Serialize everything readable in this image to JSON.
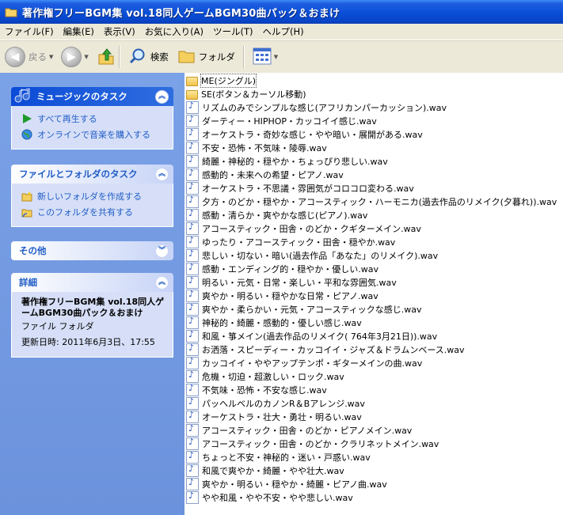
{
  "window": {
    "title": "著作権フリーBGM集 vol.18同人ゲームBGM30曲パック＆おまけ"
  },
  "menu": [
    "ファイル(F)",
    "編集(E)",
    "表示(V)",
    "お気に入り(A)",
    "ツール(T)",
    "ヘルプ(H)"
  ],
  "toolbar": {
    "back": "戻る",
    "search": "検索",
    "folders": "フォルダ"
  },
  "tasks": {
    "music": {
      "title": "ミュージックのタスク",
      "items": [
        "すべて再生する",
        "オンラインで音楽を購入する"
      ]
    },
    "file": {
      "title": "ファイルとフォルダのタスク",
      "items": [
        "新しいフォルダを作成する",
        "このフォルダを共有する"
      ]
    },
    "other": {
      "title": "その他"
    },
    "details": {
      "title": "詳細",
      "name": "著作権フリーBGM集 vol.18同人ゲームBGM30曲パック＆おまけ",
      "type": "ファイル フォルダ",
      "modified": "更新日時: 2011年6月3日、17:55"
    }
  },
  "files": [
    {
      "name": "ME(ジングル)",
      "type": "folder"
    },
    {
      "name": "SE(ボタン＆カーソル移動)",
      "type": "folder"
    },
    {
      "name": "リズムのみでシンプルな感じ(アフリカンパーカッション).wav",
      "type": "audio"
    },
    {
      "name": "ダーティー・HIPHOP・カッコイイ感じ.wav",
      "type": "audio"
    },
    {
      "name": "オーケストラ・奇妙な感じ・やや暗い・展開がある.wav",
      "type": "audio"
    },
    {
      "name": "不安・恐怖・不気味・陵辱.wav",
      "type": "audio"
    },
    {
      "name": "綺麗・神秘的・穏やか・ちょっぴり悲しい.wav",
      "type": "audio"
    },
    {
      "name": "感動的・未来への希望・ピアノ.wav",
      "type": "audio"
    },
    {
      "name": "オーケストラ・不思議・雰囲気がコロコロ変わる.wav",
      "type": "audio"
    },
    {
      "name": "夕方・のどか・穏やか・アコースティック・ハーモニカ(過去作品のリメイク(夕暮れ)).wav",
      "type": "audio"
    },
    {
      "name": "感動・清らか・爽やかな感じ(ピアノ).wav",
      "type": "audio"
    },
    {
      "name": "アコースティック・田舎・のどか・クギターメイン.wav",
      "type": "audio"
    },
    {
      "name": "ゆったり・アコースティック・田舎・穏やか.wav",
      "type": "audio"
    },
    {
      "name": "悲しい・切ない・暗い(過去作品「あなた」のリメイク).wav",
      "type": "audio"
    },
    {
      "name": "感動・エンディング的・穏やか・優しい.wav",
      "type": "audio"
    },
    {
      "name": "明るい・元気・日常・楽しい・平和な雰囲気.wav",
      "type": "audio"
    },
    {
      "name": "爽やか・明るい・穏やかな日常・ピアノ.wav",
      "type": "audio"
    },
    {
      "name": "爽やか・柔らかい・元気・アコースティックな感じ.wav",
      "type": "audio"
    },
    {
      "name": "神秘的・綺麗・感動的・優しい感じ.wav",
      "type": "audio"
    },
    {
      "name": "和風・箏メイン(過去作品のリメイク( 764年3月21日)).wav",
      "type": "audio"
    },
    {
      "name": "お洒落・スピーディー・カッコイイ・ジャズ＆ドラムンベース.wav",
      "type": "audio"
    },
    {
      "name": "カッコイイ・ややアップテンポ・ギターメインの曲.wav",
      "type": "audio"
    },
    {
      "name": "危機・切迫・超激しい・ロック.wav",
      "type": "audio"
    },
    {
      "name": "不気味・恐怖・不安な感じ.wav",
      "type": "audio"
    },
    {
      "name": "パッヘルベルのカノンR＆Bアレンジ.wav",
      "type": "audio"
    },
    {
      "name": "オーケストラ・壮大・勇壮・明るい.wav",
      "type": "audio"
    },
    {
      "name": "アコースティック・田舎・のどか・ピアノメイン.wav",
      "type": "audio"
    },
    {
      "name": "アコースティック・田舎・のどか・クラリネットメイン.wav",
      "type": "audio"
    },
    {
      "name": "ちょっと不安・神秘的・迷い・戸惑い.wav",
      "type": "audio"
    },
    {
      "name": "和風で爽やか・綺麗・やや壮大.wav",
      "type": "audio"
    },
    {
      "name": "爽やか・明るい・穏やか・綺麗・ピアノ曲.wav",
      "type": "audio"
    },
    {
      "name": "やや和風・やや不安・やや悲しい.wav",
      "type": "audio"
    }
  ]
}
